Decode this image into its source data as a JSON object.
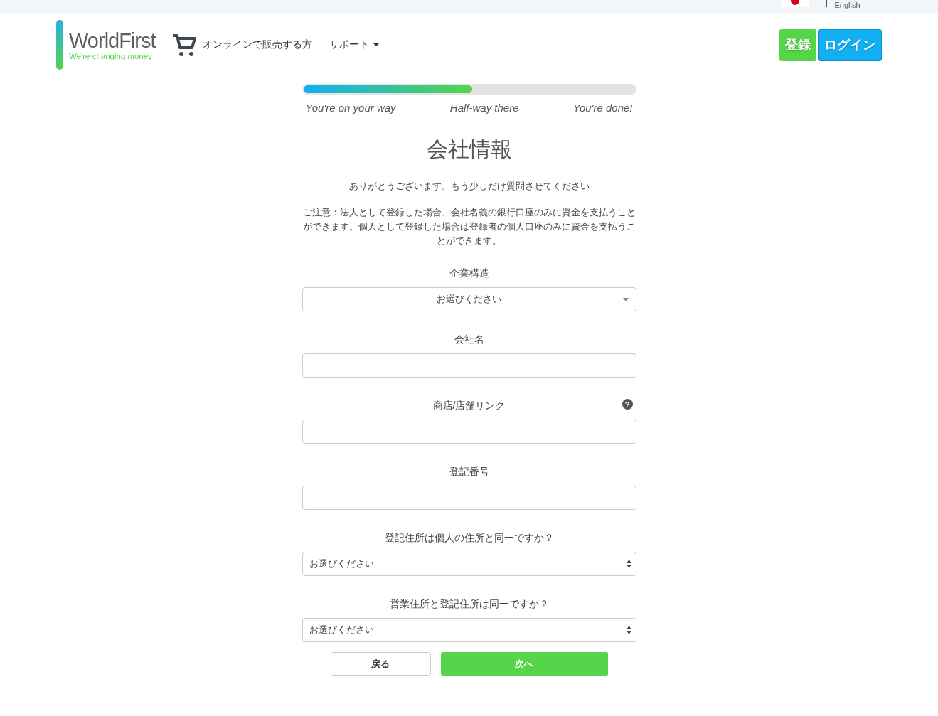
{
  "topbar": {
    "language": "English"
  },
  "logo": {
    "name": "WorldFirst",
    "tagline": "We're changing money"
  },
  "nav": [
    {
      "kind": "cart",
      "label": "オンラインで販売する方"
    },
    {
      "kind": "dropdown",
      "label": "サポート"
    }
  ],
  "auth_buttons": [
    {
      "kind": "register",
      "label": "登録"
    },
    {
      "kind": "login",
      "label": "ログイン"
    }
  ],
  "progress": {
    "level": 0.51,
    "steps": [
      "You're on your way",
      "Half-way there",
      "You're done!"
    ]
  },
  "title": "会社情報",
  "intro": "ありがとうございます。もう少しだけ質問させてください",
  "notice": "ご注意：法人として登録した場合、会社名義の銀行口座のみに資金を支払うことができます。個人として登録した場合は登録者の個人口座のみに資金を支払うことができます。",
  "fields": [
    {
      "kind": "select-centered",
      "label": "企業構造",
      "value": "お選びください"
    },
    {
      "kind": "text",
      "label": "会社名"
    },
    {
      "kind": "text",
      "label": "商店/店舗リンク",
      "help": "?"
    },
    {
      "kind": "text",
      "label": "登記番号"
    },
    {
      "kind": "select",
      "label": "登記住所は個人の住所と同一ですか？",
      "value": "お選びください"
    },
    {
      "kind": "select",
      "label": "営業住所と登記住所は同一ですか？",
      "value": "お選びください"
    }
  ],
  "buttons": {
    "back": "戻る",
    "next": "次へ"
  }
}
